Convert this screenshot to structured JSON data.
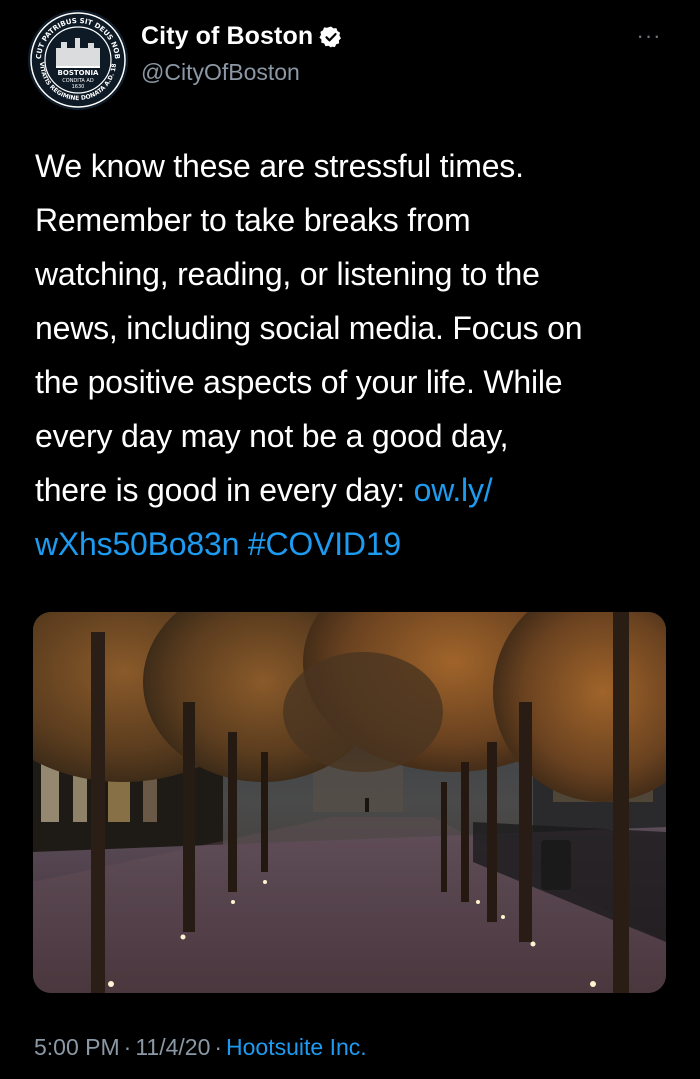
{
  "account": {
    "display_name": "City of Boston",
    "handle": "@CityOfBoston",
    "verified": true,
    "avatar": {
      "seal_text_top": "SICUT PATRIBUS SIT DEUS NOBIS",
      "seal_center": "BOSTONIA",
      "seal_sub1": "CONDITA AD",
      "seal_sub2": "1630",
      "seal_bottom": "CIVITATIS REGIMINE DONATA A.D. 1822"
    }
  },
  "tweet": {
    "lines": [
      "We know these are stressful times.",
      "Remember to take breaks from",
      "watching, reading, or listening to the",
      "news, including social media. Focus on",
      "the positive aspects of your life. While",
      "every day may not be a good day,",
      "there is good in every day: "
    ],
    "link_part1": "ow.ly/",
    "link_part2": "wXhs50Bo83n",
    "hashtag": "#COVID19"
  },
  "media": {
    "description_icon": "photo-icon"
  },
  "meta": {
    "time": "5:00 PM",
    "dot": "·",
    "date": "11/4/20",
    "source": "Hootsuite Inc."
  },
  "colors": {
    "background": "#000000",
    "text": "#ffffff",
    "secondary": "#8b98a5",
    "link": "#1d9bf0"
  }
}
